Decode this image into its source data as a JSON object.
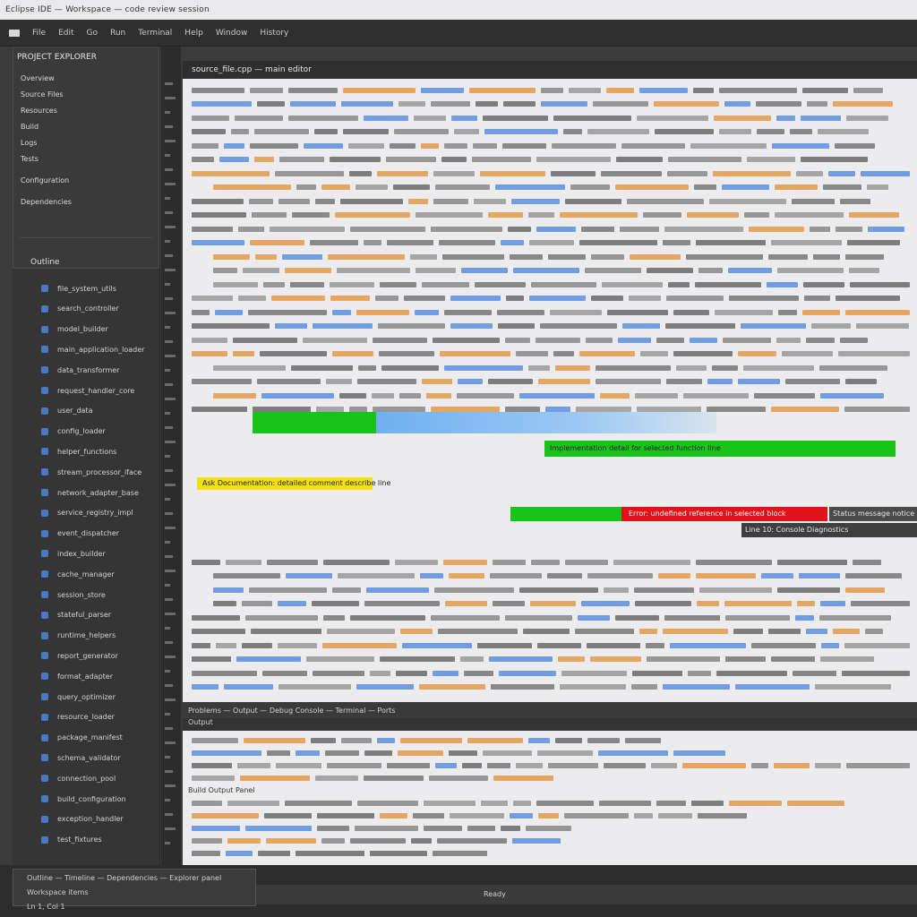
{
  "titlebar": {
    "text": "Eclipse IDE — Workspace — code review session"
  },
  "menubar": {
    "items": [
      "File",
      "Edit",
      "Go",
      "Run",
      "Terminal",
      "Help",
      "Window",
      "History"
    ]
  },
  "sidebar": {
    "title": "PROJECT EXPLORER",
    "items": [
      "Overview",
      "Source Files",
      "Resources",
      "Build",
      "Logs",
      "Tests",
      "Configuration",
      "Dependencies"
    ],
    "section_title": "Outline",
    "tree": [
      "file_system_utils",
      "search_controller",
      "model_builder",
      "main_application_loader",
      "data_transformer",
      "request_handler_core",
      "user_data",
      "config_loader",
      "helper_functions",
      "stream_processor_iface",
      "network_adapter_base",
      "service_registry_impl",
      "event_dispatcher",
      "index_builder",
      "cache_manager",
      "session_store",
      "stateful_parser",
      "runtime_helpers",
      "report_generator",
      "format_adapter",
      "query_optimizer",
      "resource_loader",
      "package_manifest",
      "schema_validator",
      "connection_pool",
      "build_configuration",
      "exception_handler",
      "test_fixtures"
    ]
  },
  "editor": {
    "tab_label": "source_file.cpp — main editor",
    "highlights": {
      "yellow": "Ask Documentation: detailed comment describe line",
      "green_box": "Implementation detail for selected function line",
      "red_bar": "Error: undefined reference in selected block",
      "dark_box_1": "Status message notice",
      "dark_box_2": "Line 10: Console Diagnostics"
    }
  },
  "status_strip": {
    "text": "Problems — Output — Debug Console — Terminal — Ports"
  },
  "panel": {
    "tab_label": "Output",
    "heading": "Build Output Panel"
  },
  "bottombar": {
    "left_line_1": "Outline — Timeline — Dependencies — Explorer panel",
    "left_line_2": "Workspace items",
    "left_line_3": "Ln 1, Col 1",
    "center_label": "Ready"
  },
  "colors": {
    "green": "#18c41a",
    "yellow": "#f2e10a",
    "red": "#e2121a",
    "blue_token": "#5d8fe0",
    "orange_token": "#e59a4a"
  }
}
